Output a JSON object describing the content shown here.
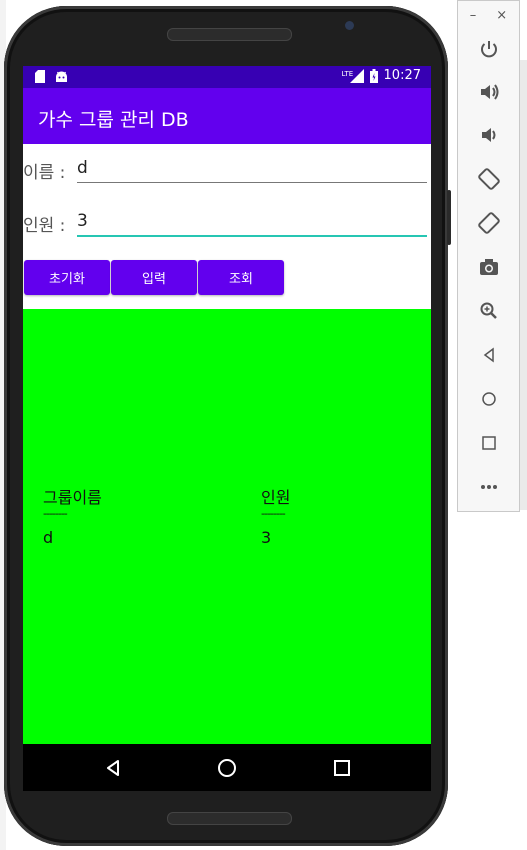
{
  "app": {
    "title": "가수 그룹 관리 DB"
  },
  "statusbar": {
    "network": "LTE",
    "time": "10:27"
  },
  "form": {
    "name_label": "이름 :",
    "name_value": "d",
    "count_label": "인원 :",
    "count_value": "3"
  },
  "buttons": {
    "reset": "초기화",
    "insert": "입력",
    "query": "조회"
  },
  "results": {
    "columns": [
      "그룹이름",
      "인원"
    ],
    "separators": [
      "--------",
      "--------"
    ],
    "rows": [
      {
        "group": "d",
        "count": "3"
      }
    ]
  },
  "colors": {
    "statusbar": "#3700b3",
    "appbar": "#6200ee",
    "button": "#6200ee",
    "result_bg": "#00ff00",
    "input_focus": "#26c6b3"
  },
  "emulator_toolbar": {
    "icons": [
      "power-icon",
      "volume-up-icon",
      "volume-down-icon",
      "rotate-left-icon",
      "rotate-right-icon",
      "camera-icon",
      "zoom-icon",
      "back-icon",
      "home-icon",
      "overview-icon",
      "more-icon"
    ],
    "window_controls": [
      "minimize-icon",
      "close-icon"
    ]
  }
}
